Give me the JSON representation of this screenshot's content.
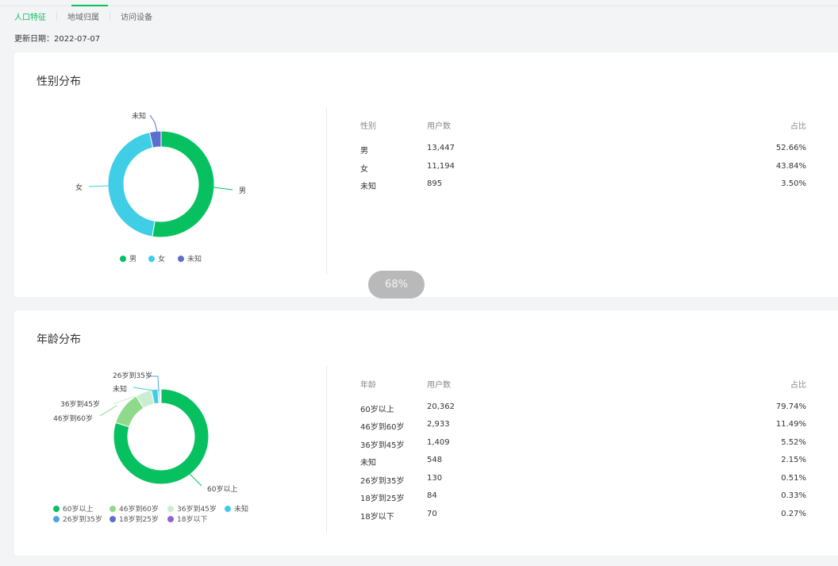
{
  "tabs": [
    {
      "label": "人口特征",
      "active": true
    },
    {
      "label": "地域归属",
      "active": false
    },
    {
      "label": "访问设备",
      "active": false
    }
  ],
  "update": {
    "label": "更新日期：",
    "date": "2022-07-07"
  },
  "progress_badge": "68%",
  "gender": {
    "title": "性别分布",
    "headers": [
      "性别",
      "用户数",
      "占比"
    ],
    "rows": [
      [
        "男",
        "13,447",
        "52.66%"
      ],
      [
        "女",
        "11,194",
        "43.84%"
      ],
      [
        "未知",
        "895",
        "3.50%"
      ]
    ]
  },
  "age": {
    "title": "年龄分布",
    "headers": [
      "年龄",
      "用户数",
      "占比"
    ],
    "rows": [
      [
        "60岁以上",
        "20,362",
        "79.74%"
      ],
      [
        "46岁到60岁",
        "2,933",
        "11.49%"
      ],
      [
        "36岁到45岁",
        "1,409",
        "5.52%"
      ],
      [
        "未知",
        "548",
        "2.15%"
      ],
      [
        "26岁到35岁",
        "130",
        "0.51%"
      ],
      [
        "18岁到25岁",
        "84",
        "0.33%"
      ],
      [
        "18岁以下",
        "70",
        "0.27%"
      ]
    ]
  },
  "chart_data": [
    {
      "type": "pie",
      "categories": [
        "男",
        "女",
        "未知"
      ],
      "values": [
        13447,
        11194,
        895
      ],
      "colors": [
        "#07c160",
        "#3fcee6",
        "#5b6fd1"
      ],
      "legend": "bottom"
    },
    {
      "type": "pie",
      "categories": [
        "60岁以上",
        "46岁到60岁",
        "36岁到45岁",
        "未知",
        "26岁到35岁",
        "18岁到25岁",
        "18岁以下"
      ],
      "values": [
        20362,
        2933,
        1409,
        548,
        130,
        84,
        70
      ],
      "colors": [
        "#07c160",
        "#8fd98b",
        "#c9efd0",
        "#3fcee6",
        "#4aa3e6",
        "#5b6fd1",
        "#9162d9"
      ],
      "legend": "bottom"
    }
  ]
}
